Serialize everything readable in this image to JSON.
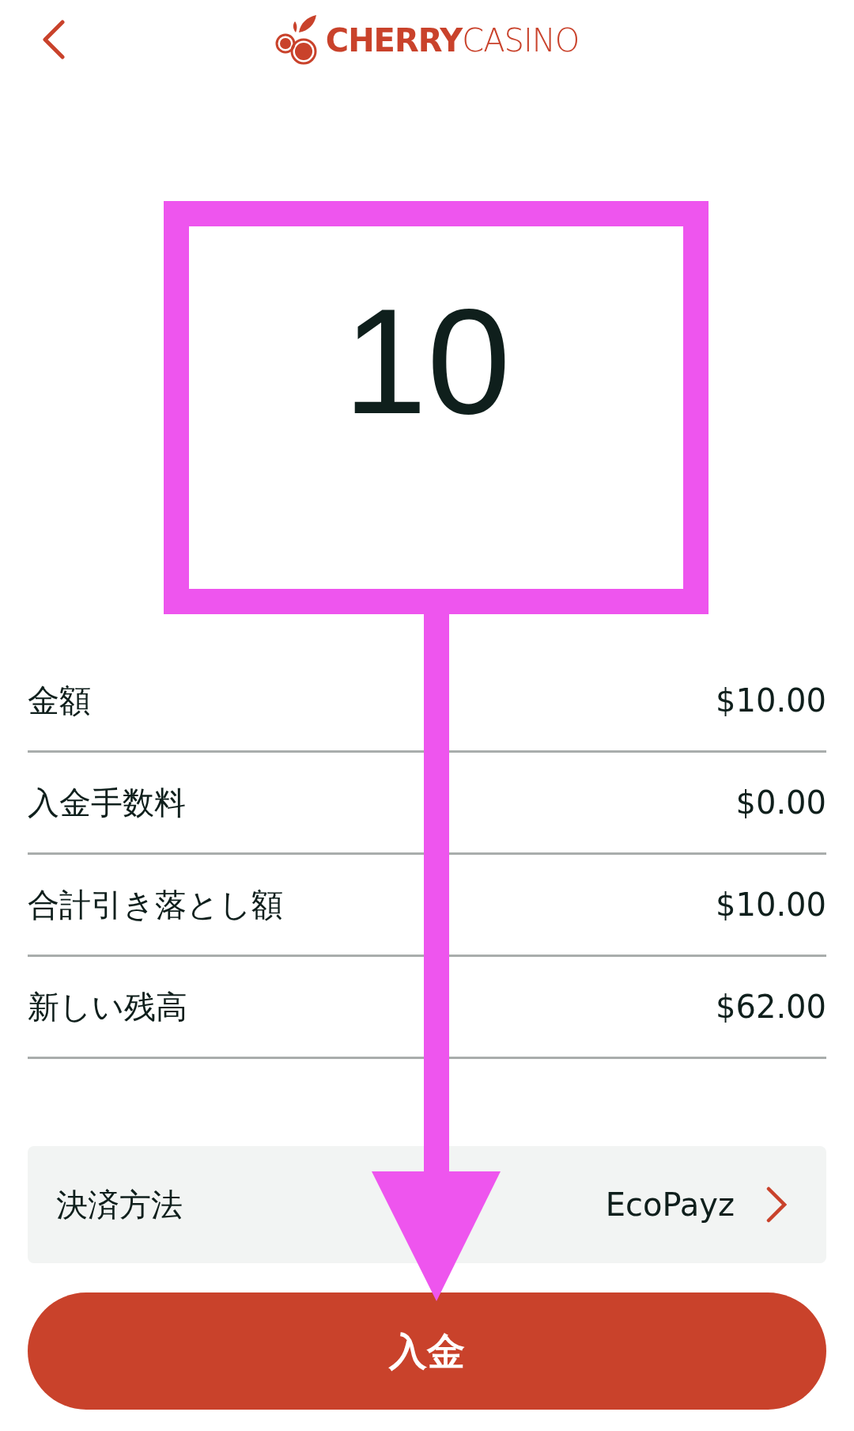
{
  "header": {
    "logo": {
      "bold": "CHERRY",
      "light": "CASINO"
    }
  },
  "amount": {
    "value": "10"
  },
  "summary": [
    {
      "label": "金額",
      "value": "$10.00"
    },
    {
      "label": "入金手数料",
      "value": "$0.00"
    },
    {
      "label": "合計引き落とし額",
      "value": "$10.00"
    },
    {
      "label": "新しい残高",
      "value": "$62.00"
    }
  ],
  "payment_method": {
    "label": "決済方法",
    "value": "EcoPayz"
  },
  "submit": {
    "label": "入金"
  }
}
